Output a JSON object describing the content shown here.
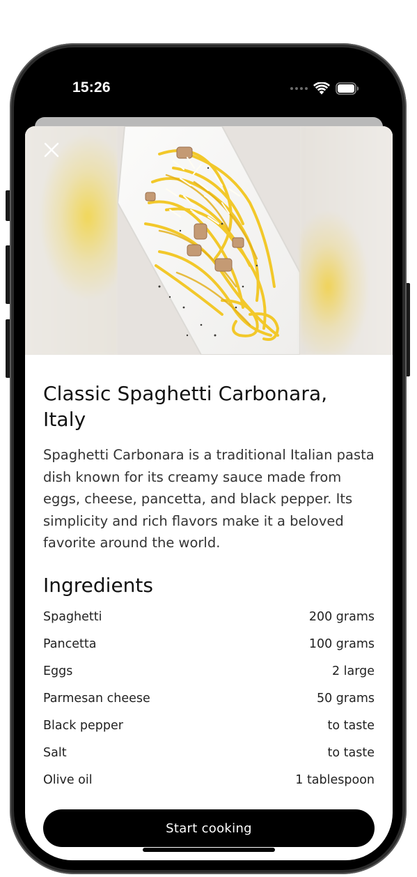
{
  "status_bar": {
    "time": "15:26",
    "icons": [
      "cellular-signal-icon",
      "wifi-icon",
      "battery-icon"
    ]
  },
  "hero": {
    "close_icon": "close-icon"
  },
  "recipe": {
    "title": "Classic Spaghetti Carbonara, Italy",
    "description": "Spaghetti Carbonara is a traditional Italian pasta dish known for its creamy sauce made from eggs, cheese, pancetta, and black pepper. Its simplicity and rich flavors make it a beloved favorite around the world."
  },
  "ingredients": {
    "heading": "Ingredients",
    "items": [
      {
        "name": "Spaghetti",
        "amount": "200 grams"
      },
      {
        "name": "Pancetta",
        "amount": "100 grams"
      },
      {
        "name": "Eggs",
        "amount": "2 large"
      },
      {
        "name": "Parmesan cheese",
        "amount": "50 grams"
      },
      {
        "name": "Black pepper",
        "amount": "to taste"
      },
      {
        "name": "Salt",
        "amount": "to taste"
      },
      {
        "name": "Olive oil",
        "amount": "1 tablespoon"
      }
    ]
  },
  "actions": {
    "start_cooking_label": "Start cooking"
  },
  "colors": {
    "sheet_background": "#ffffff",
    "primary_button": "#000000",
    "text_primary": "#111111",
    "text_secondary": "#333333"
  }
}
